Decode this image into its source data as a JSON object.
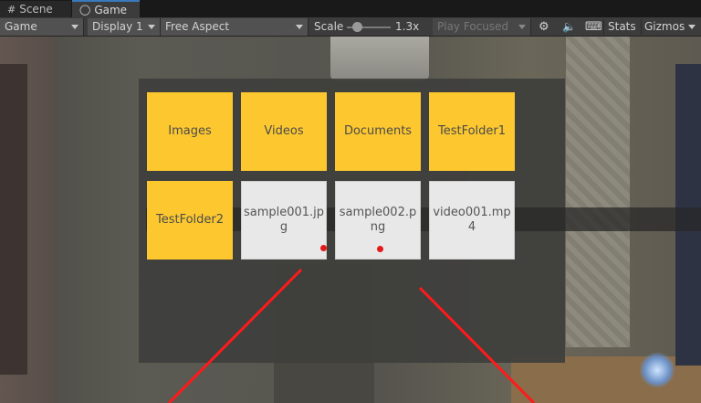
{
  "tabs": [
    {
      "label": "Scene",
      "icon": "grid-icon"
    },
    {
      "label": "Game",
      "icon": "gamepad-icon"
    }
  ],
  "toolbar": {
    "view_mode": "Game",
    "display": "Display 1",
    "aspect": "Free Aspect",
    "scale_label": "Scale",
    "scale_value": "1.3x",
    "play_mode": "Play Focused",
    "stats_label": "Stats",
    "gizmos_label": "Gizmos"
  },
  "browser": {
    "folders": [
      "Images",
      "Videos",
      "Documents",
      "TestFolder1",
      "TestFolder2"
    ],
    "files": [
      "sample001.jpg",
      "sample002.png",
      "video001.mp4"
    ]
  },
  "colors": {
    "folder_tile": "#fdc82f",
    "file_tile": "#e8e8e8",
    "pointer_ray": "#ff1a1a"
  }
}
